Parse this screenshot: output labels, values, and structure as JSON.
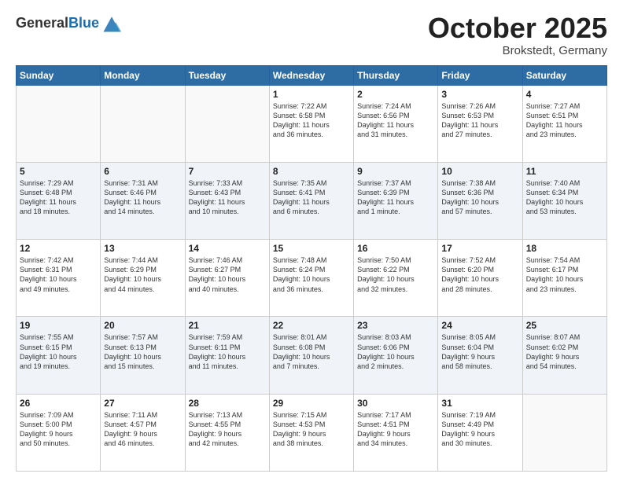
{
  "header": {
    "logo_general": "General",
    "logo_blue": "Blue",
    "month": "October 2025",
    "location": "Brokstedt, Germany"
  },
  "weekdays": [
    "Sunday",
    "Monday",
    "Tuesday",
    "Wednesday",
    "Thursday",
    "Friday",
    "Saturday"
  ],
  "weeks": [
    [
      {
        "day": "",
        "info": ""
      },
      {
        "day": "",
        "info": ""
      },
      {
        "day": "",
        "info": ""
      },
      {
        "day": "1",
        "info": "Sunrise: 7:22 AM\nSunset: 6:58 PM\nDaylight: 11 hours\nand 36 minutes."
      },
      {
        "day": "2",
        "info": "Sunrise: 7:24 AM\nSunset: 6:56 PM\nDaylight: 11 hours\nand 31 minutes."
      },
      {
        "day": "3",
        "info": "Sunrise: 7:26 AM\nSunset: 6:53 PM\nDaylight: 11 hours\nand 27 minutes."
      },
      {
        "day": "4",
        "info": "Sunrise: 7:27 AM\nSunset: 6:51 PM\nDaylight: 11 hours\nand 23 minutes."
      }
    ],
    [
      {
        "day": "5",
        "info": "Sunrise: 7:29 AM\nSunset: 6:48 PM\nDaylight: 11 hours\nand 18 minutes."
      },
      {
        "day": "6",
        "info": "Sunrise: 7:31 AM\nSunset: 6:46 PM\nDaylight: 11 hours\nand 14 minutes."
      },
      {
        "day": "7",
        "info": "Sunrise: 7:33 AM\nSunset: 6:43 PM\nDaylight: 11 hours\nand 10 minutes."
      },
      {
        "day": "8",
        "info": "Sunrise: 7:35 AM\nSunset: 6:41 PM\nDaylight: 11 hours\nand 6 minutes."
      },
      {
        "day": "9",
        "info": "Sunrise: 7:37 AM\nSunset: 6:39 PM\nDaylight: 11 hours\nand 1 minute."
      },
      {
        "day": "10",
        "info": "Sunrise: 7:38 AM\nSunset: 6:36 PM\nDaylight: 10 hours\nand 57 minutes."
      },
      {
        "day": "11",
        "info": "Sunrise: 7:40 AM\nSunset: 6:34 PM\nDaylight: 10 hours\nand 53 minutes."
      }
    ],
    [
      {
        "day": "12",
        "info": "Sunrise: 7:42 AM\nSunset: 6:31 PM\nDaylight: 10 hours\nand 49 minutes."
      },
      {
        "day": "13",
        "info": "Sunrise: 7:44 AM\nSunset: 6:29 PM\nDaylight: 10 hours\nand 44 minutes."
      },
      {
        "day": "14",
        "info": "Sunrise: 7:46 AM\nSunset: 6:27 PM\nDaylight: 10 hours\nand 40 minutes."
      },
      {
        "day": "15",
        "info": "Sunrise: 7:48 AM\nSunset: 6:24 PM\nDaylight: 10 hours\nand 36 minutes."
      },
      {
        "day": "16",
        "info": "Sunrise: 7:50 AM\nSunset: 6:22 PM\nDaylight: 10 hours\nand 32 minutes."
      },
      {
        "day": "17",
        "info": "Sunrise: 7:52 AM\nSunset: 6:20 PM\nDaylight: 10 hours\nand 28 minutes."
      },
      {
        "day": "18",
        "info": "Sunrise: 7:54 AM\nSunset: 6:17 PM\nDaylight: 10 hours\nand 23 minutes."
      }
    ],
    [
      {
        "day": "19",
        "info": "Sunrise: 7:55 AM\nSunset: 6:15 PM\nDaylight: 10 hours\nand 19 minutes."
      },
      {
        "day": "20",
        "info": "Sunrise: 7:57 AM\nSunset: 6:13 PM\nDaylight: 10 hours\nand 15 minutes."
      },
      {
        "day": "21",
        "info": "Sunrise: 7:59 AM\nSunset: 6:11 PM\nDaylight: 10 hours\nand 11 minutes."
      },
      {
        "day": "22",
        "info": "Sunrise: 8:01 AM\nSunset: 6:08 PM\nDaylight: 10 hours\nand 7 minutes."
      },
      {
        "day": "23",
        "info": "Sunrise: 8:03 AM\nSunset: 6:06 PM\nDaylight: 10 hours\nand 2 minutes."
      },
      {
        "day": "24",
        "info": "Sunrise: 8:05 AM\nSunset: 6:04 PM\nDaylight: 9 hours\nand 58 minutes."
      },
      {
        "day": "25",
        "info": "Sunrise: 8:07 AM\nSunset: 6:02 PM\nDaylight: 9 hours\nand 54 minutes."
      }
    ],
    [
      {
        "day": "26",
        "info": "Sunrise: 7:09 AM\nSunset: 5:00 PM\nDaylight: 9 hours\nand 50 minutes."
      },
      {
        "day": "27",
        "info": "Sunrise: 7:11 AM\nSunset: 4:57 PM\nDaylight: 9 hours\nand 46 minutes."
      },
      {
        "day": "28",
        "info": "Sunrise: 7:13 AM\nSunset: 4:55 PM\nDaylight: 9 hours\nand 42 minutes."
      },
      {
        "day": "29",
        "info": "Sunrise: 7:15 AM\nSunset: 4:53 PM\nDaylight: 9 hours\nand 38 minutes."
      },
      {
        "day": "30",
        "info": "Sunrise: 7:17 AM\nSunset: 4:51 PM\nDaylight: 9 hours\nand 34 minutes."
      },
      {
        "day": "31",
        "info": "Sunrise: 7:19 AM\nSunset: 4:49 PM\nDaylight: 9 hours\nand 30 minutes."
      },
      {
        "day": "",
        "info": ""
      }
    ]
  ]
}
